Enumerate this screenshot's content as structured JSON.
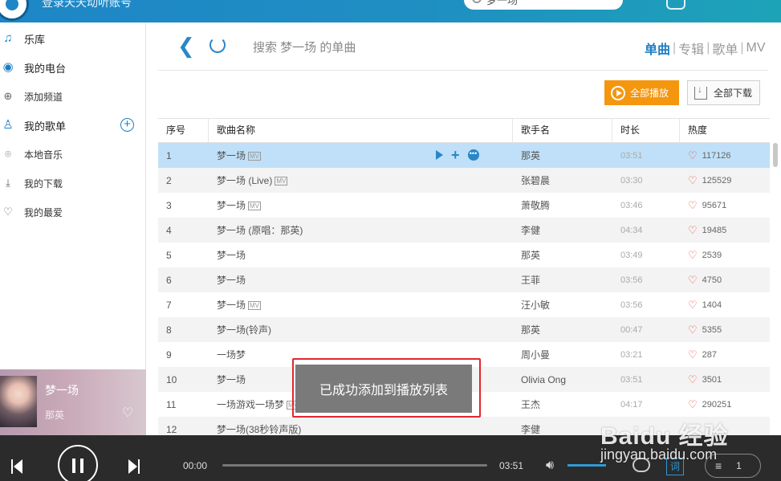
{
  "topbar": {
    "login_text": "登录天天动听账号",
    "search_value": "梦一场"
  },
  "sidebar": {
    "items": [
      {
        "label": "乐库",
        "icon": "music-note-icon"
      },
      {
        "label": "我的电台",
        "icon": "radio-icon"
      },
      {
        "label": "添加频道",
        "icon": "add-channel-icon"
      },
      {
        "label": "我的歌单",
        "icon": "user-icon"
      },
      {
        "label": "本地音乐",
        "icon": "location-icon"
      },
      {
        "label": "我的下载",
        "icon": "download-icon"
      },
      {
        "label": "我的最爱",
        "icon": "heart-icon"
      }
    ]
  },
  "now_playing": {
    "title": "梦一场",
    "artist": "那英"
  },
  "content": {
    "search_title": "搜索 梦一场 的单曲",
    "tabs": [
      "单曲",
      "专辑",
      "歌单",
      "MV"
    ],
    "active_tab": "单曲",
    "play_all_label": "全部播放",
    "download_all_label": "全部下载",
    "columns": [
      "序号",
      "歌曲名称",
      "歌手名",
      "时长",
      "热度"
    ],
    "rows": [
      {
        "no": "1",
        "title": "梦一场",
        "mv": true,
        "artist": "那英",
        "duration": "03:51",
        "heat": "117126",
        "selected": true
      },
      {
        "no": "2",
        "title": "梦一场 (Live)",
        "mv": true,
        "artist": "张碧晨",
        "duration": "03:30",
        "heat": "125529"
      },
      {
        "no": "3",
        "title": "梦一场",
        "mv": true,
        "artist": "萧敬腾",
        "duration": "03:46",
        "heat": "95671"
      },
      {
        "no": "4",
        "title": "梦一场 (原唱：那英)",
        "mv": false,
        "artist": "李健",
        "duration": "04:34",
        "heat": "19485"
      },
      {
        "no": "5",
        "title": "梦一场",
        "mv": false,
        "artist": "那英",
        "duration": "03:49",
        "heat": "2539"
      },
      {
        "no": "6",
        "title": "梦一场",
        "mv": false,
        "artist": "王菲",
        "duration": "03:56",
        "heat": "4750"
      },
      {
        "no": "7",
        "title": "梦一场",
        "mv": true,
        "artist": "汪小敏",
        "duration": "03:56",
        "heat": "1404"
      },
      {
        "no": "8",
        "title": "梦一场(铃声)",
        "mv": false,
        "artist": "那英",
        "duration": "00:47",
        "heat": "5355"
      },
      {
        "no": "9",
        "title": "一场梦",
        "mv": false,
        "artist": "周小曼",
        "duration": "03:21",
        "heat": "287"
      },
      {
        "no": "10",
        "title": "梦一场",
        "mv": false,
        "artist": "Olivia Ong",
        "duration": "03:51",
        "heat": "3501"
      },
      {
        "no": "11",
        "title": "一场游戏一场梦",
        "mv": true,
        "artist": "王杰",
        "duration": "04:17",
        "heat": "290251"
      },
      {
        "no": "12",
        "title": "梦一场(38秒铃声版)",
        "mv": false,
        "artist": "李健",
        "duration": "",
        "heat": ""
      }
    ]
  },
  "toast": {
    "message": "已成功添加到播放列表"
  },
  "player": {
    "current_time": "00:00",
    "total_time": "03:51",
    "progress": 0,
    "volume": 1.0,
    "lyric_label": "词",
    "playlist_count": "1"
  },
  "watermark": {
    "logo": "Baidu 经验",
    "url": "jingyan.baidu.com"
  },
  "colors": {
    "accent": "#1f7ec3",
    "topbar": "#1e86c7",
    "play_all": "#f5960f",
    "heat": "#e8533d",
    "selected_row": "#bfe0f8",
    "toast_frame": "#e3262e"
  }
}
